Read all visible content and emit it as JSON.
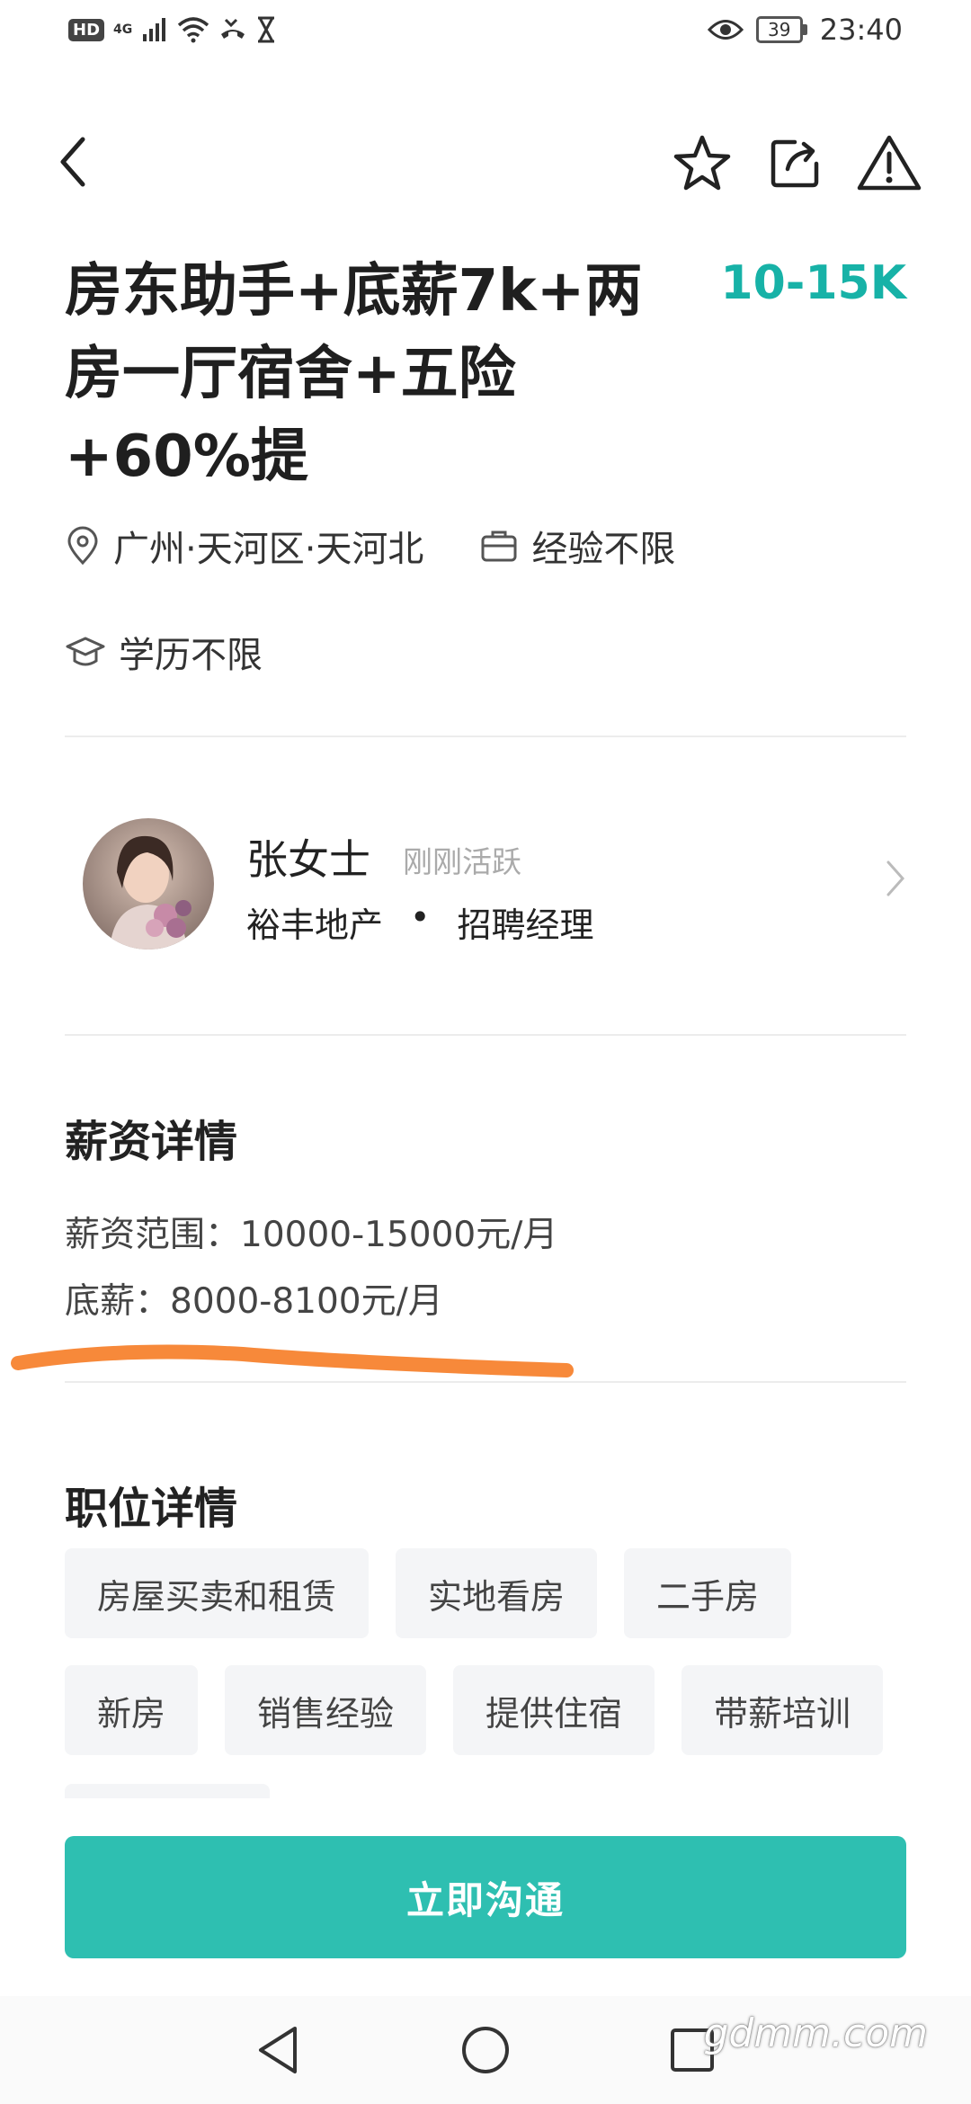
{
  "status_bar": {
    "hd": "HD",
    "network": "4G",
    "battery": "39",
    "time": "23:40"
  },
  "job": {
    "title": "房东助手+底薪7k+两房一厅宿舍+五险+60%提",
    "salary": "10-15K",
    "location": "广州·天河区·天河北",
    "experience": "经验不限",
    "education": "学历不限"
  },
  "recruiter": {
    "name": "张女士",
    "status": "刚刚活跃",
    "company": "裕丰地产",
    "separator": "•",
    "role": "招聘经理"
  },
  "salary_section": {
    "title": "薪资详情",
    "range": "薪资范围：10000-15000元/月",
    "base": "底薪：8000-8100元/月"
  },
  "position_section": {
    "title": "职位详情",
    "tags": [
      "房屋买卖和租赁",
      "实地看房",
      "二手房",
      "新房",
      "销售经验",
      "提供住宿",
      "带薪培训"
    ]
  },
  "cta": {
    "label": "立即沟通"
  },
  "watermark": "gdmm.com",
  "colors": {
    "accent": "#17b2a7",
    "cta": "#2ebfb1",
    "highlight": "#f7893a"
  }
}
